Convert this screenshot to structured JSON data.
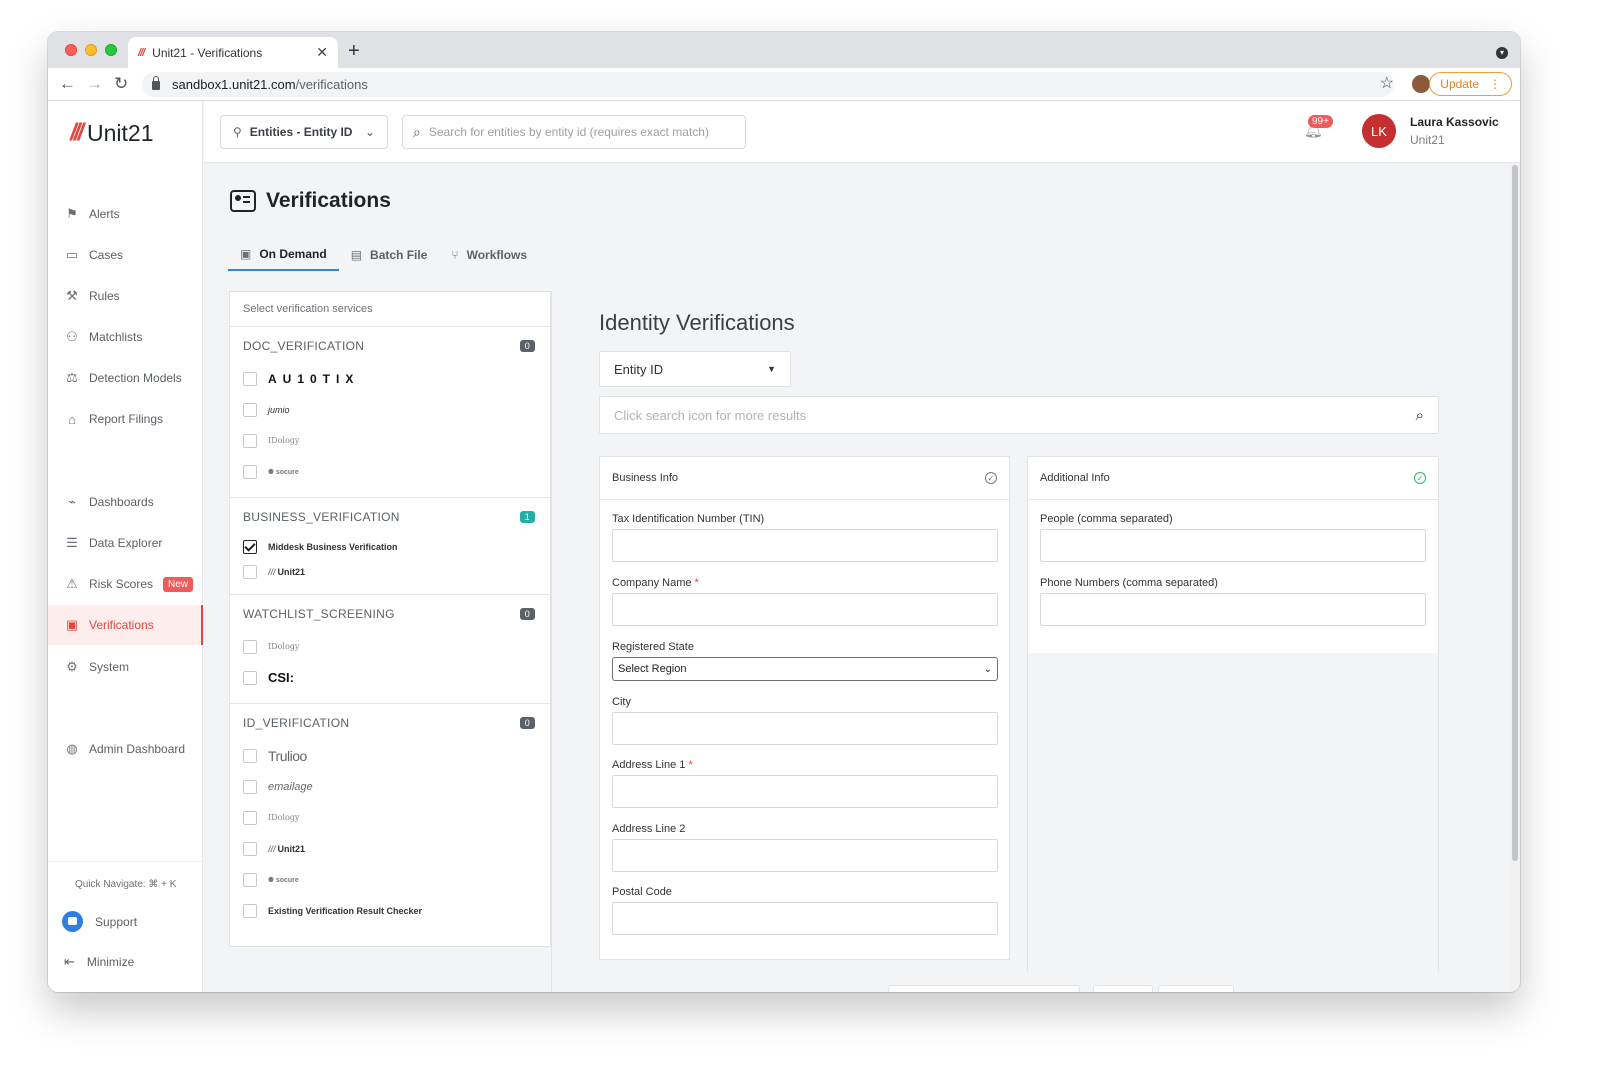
{
  "browser": {
    "tab_title": "Unit21 - Verifications",
    "url_host": "sandbox1.unit21.com",
    "url_path": "/verifications",
    "update_label": "Update"
  },
  "app": {
    "brand": "Unit21",
    "sidebar": {
      "items": [
        {
          "label": "Alerts",
          "icon": "flag-icon"
        },
        {
          "label": "Cases",
          "icon": "briefcase-icon"
        },
        {
          "label": "Rules",
          "icon": "rules-icon"
        },
        {
          "label": "Matchlists",
          "icon": "user-list-icon"
        },
        {
          "label": "Detection Models",
          "icon": "scale-icon"
        },
        {
          "label": "Report Filings",
          "icon": "building-icon"
        },
        {
          "label": "Dashboards",
          "icon": "chart-icon"
        },
        {
          "label": "Data Explorer",
          "icon": "data-explorer-icon"
        },
        {
          "label": "Risk Scores",
          "icon": "warning-icon",
          "badge": "New"
        },
        {
          "label": "Verifications",
          "icon": "id-card-icon",
          "active": true
        },
        {
          "label": "System",
          "icon": "gear-icon"
        },
        {
          "label": "Admin Dashboard",
          "icon": "globe-icon"
        }
      ],
      "quick_navigate": "Quick Navigate: ⌘ + K",
      "support": "Support",
      "minimize": "Minimize"
    },
    "topbar": {
      "entity_select": "Entities - Entity ID",
      "search_placeholder": "Search for entities by entity id (requires exact match)",
      "notifications_badge": "99+",
      "user_initials": "LK",
      "user_name": "Laura Kassovic",
      "user_org": "Unit21"
    },
    "page": {
      "title": "Verifications",
      "tabs": [
        {
          "label": "On Demand",
          "active": true
        },
        {
          "label": "Batch File"
        },
        {
          "label": "Workflows"
        }
      ]
    },
    "services": {
      "header": "Select verification services",
      "groups": [
        {
          "name": "DOC_VERIFICATION",
          "count": "0",
          "items": [
            "AU10TIX",
            "jumio",
            "IDology",
            "socure"
          ]
        },
        {
          "name": "BUSINESS_VERIFICATION",
          "count": "1",
          "items": [
            "Middesk Business Verification",
            "Unit21"
          ]
        },
        {
          "name": "WATCHLIST_SCREENING",
          "count": "0",
          "items": [
            "IDology",
            "CSI:"
          ]
        },
        {
          "name": "ID_VERIFICATION",
          "count": "0",
          "items": [
            "Trulioo",
            "emailage",
            "IDology",
            "Unit21",
            "socure",
            "Existing Verification Result Checker"
          ]
        }
      ]
    },
    "identity": {
      "title": "Identity Verifications",
      "select_value": "Entity ID",
      "search_placeholder": "Click search icon for more results",
      "business_info": {
        "title": "Business Info",
        "fields": {
          "tin": "Tax Identification Number (TIN)",
          "company": "Company Name",
          "state": "Registered State",
          "state_value": "Select Region",
          "city": "City",
          "addr1": "Address Line 1",
          "addr2": "Address Line 2",
          "postal": "Postal Code"
        }
      },
      "additional_info": {
        "title": "Additional Info",
        "fields": {
          "people": "People (comma separated)",
          "phones": "Phone Numbers (comma separated)"
        }
      }
    }
  }
}
